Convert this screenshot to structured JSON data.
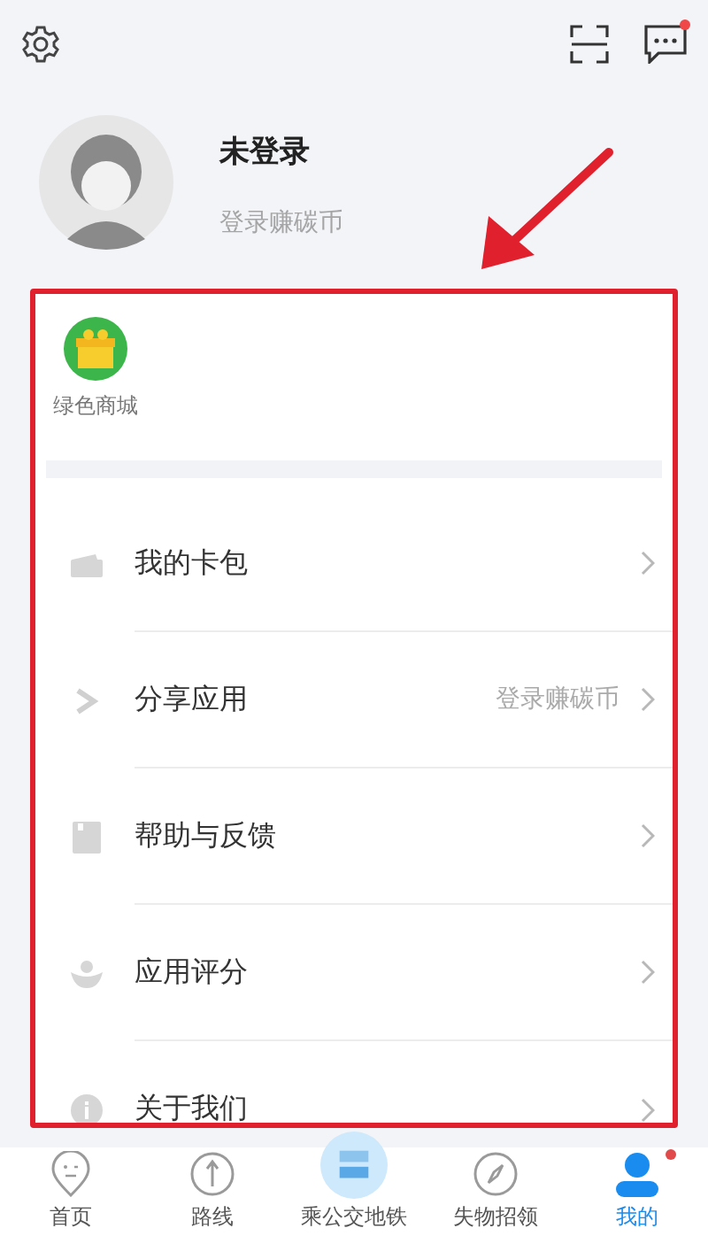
{
  "header": {
    "message_badge": true
  },
  "profile": {
    "name": "未登录",
    "subtitle": "登录赚碳币"
  },
  "shortcuts": [
    {
      "label": "绿色商城"
    }
  ],
  "menu": [
    {
      "kind": "wallet",
      "label": "我的卡包"
    },
    {
      "kind": "share",
      "label": "分享应用",
      "value": "登录赚碳币"
    },
    {
      "kind": "help",
      "label": "帮助与反馈"
    },
    {
      "kind": "rate",
      "label": "应用评分"
    },
    {
      "kind": "info",
      "label": "关于我们"
    }
  ],
  "tabs": [
    {
      "kind": "home",
      "label": "首页",
      "selected": false,
      "badge": false
    },
    {
      "kind": "route",
      "label": "路线",
      "selected": false,
      "badge": false
    },
    {
      "kind": "ride",
      "label": "乘公交地铁",
      "selected": false,
      "badge": false
    },
    {
      "kind": "lost",
      "label": "失物招领",
      "selected": false,
      "badge": false
    },
    {
      "kind": "me",
      "label": "我的",
      "selected": true,
      "badge": true
    }
  ]
}
